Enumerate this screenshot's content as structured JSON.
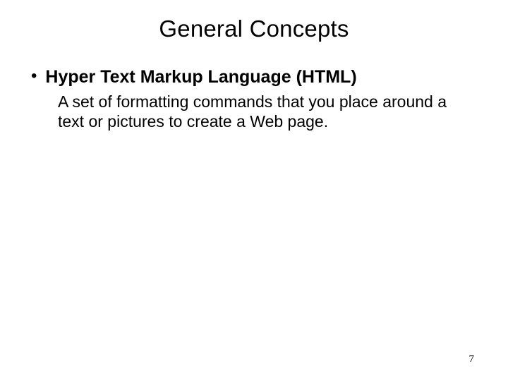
{
  "title": "General Concepts",
  "bullet": {
    "dot": "•",
    "heading": "Hyper Text Markup Language (HTML)",
    "description": "A set of formatting commands that you place around a text or pictures to create a Web page."
  },
  "page_number": "7"
}
